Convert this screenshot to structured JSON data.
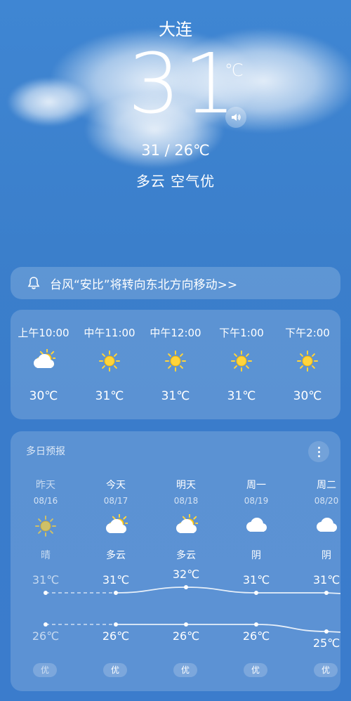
{
  "header": {
    "city": "大连",
    "temp": "31",
    "unit": "℃",
    "hilo": "31 / 26℃",
    "condition": "多云  空气优"
  },
  "alert": {
    "text": "台风“安比”将转向东北方向移动>>"
  },
  "hourly": [
    {
      "time": "上午10:00",
      "icon": "partly-cloudy-icon",
      "temp": "30℃"
    },
    {
      "time": "中午11:00",
      "icon": "sun-icon",
      "temp": "31℃"
    },
    {
      "time": "中午12:00",
      "icon": "sun-icon",
      "temp": "31℃"
    },
    {
      "time": "下午1:00",
      "icon": "sun-icon",
      "temp": "31℃"
    },
    {
      "time": "下午2:00",
      "icon": "sun-icon",
      "temp": "30℃"
    }
  ],
  "daily": {
    "title": "多日预报",
    "days": [
      {
        "name": "昨天",
        "date": "08/16",
        "icon": "sun-icon",
        "weather": "晴",
        "high": "31℃",
        "low": "26℃",
        "high_value": 31,
        "low_value": 26,
        "aq": "优"
      },
      {
        "name": "今天",
        "date": "08/17",
        "icon": "partly-cloudy-icon",
        "weather": "多云",
        "high": "31℃",
        "low": "26℃",
        "high_value": 31,
        "low_value": 26,
        "aq": "优"
      },
      {
        "name": "明天",
        "date": "08/18",
        "icon": "partly-cloudy-icon",
        "weather": "多云",
        "high": "32℃",
        "low": "26℃",
        "high_value": 32,
        "low_value": 26,
        "aq": "优"
      },
      {
        "name": "周一",
        "date": "08/19",
        "icon": "cloudy-icon",
        "weather": "阴",
        "high": "31℃",
        "low": "26℃",
        "high_value": 31,
        "low_value": 26,
        "aq": "优"
      },
      {
        "name": "周二",
        "date": "08/20",
        "icon": "cloudy-icon",
        "weather": "阴",
        "high": "31℃",
        "low": "25℃",
        "high_value": 31,
        "low_value": 25,
        "aq": "优"
      }
    ]
  }
}
